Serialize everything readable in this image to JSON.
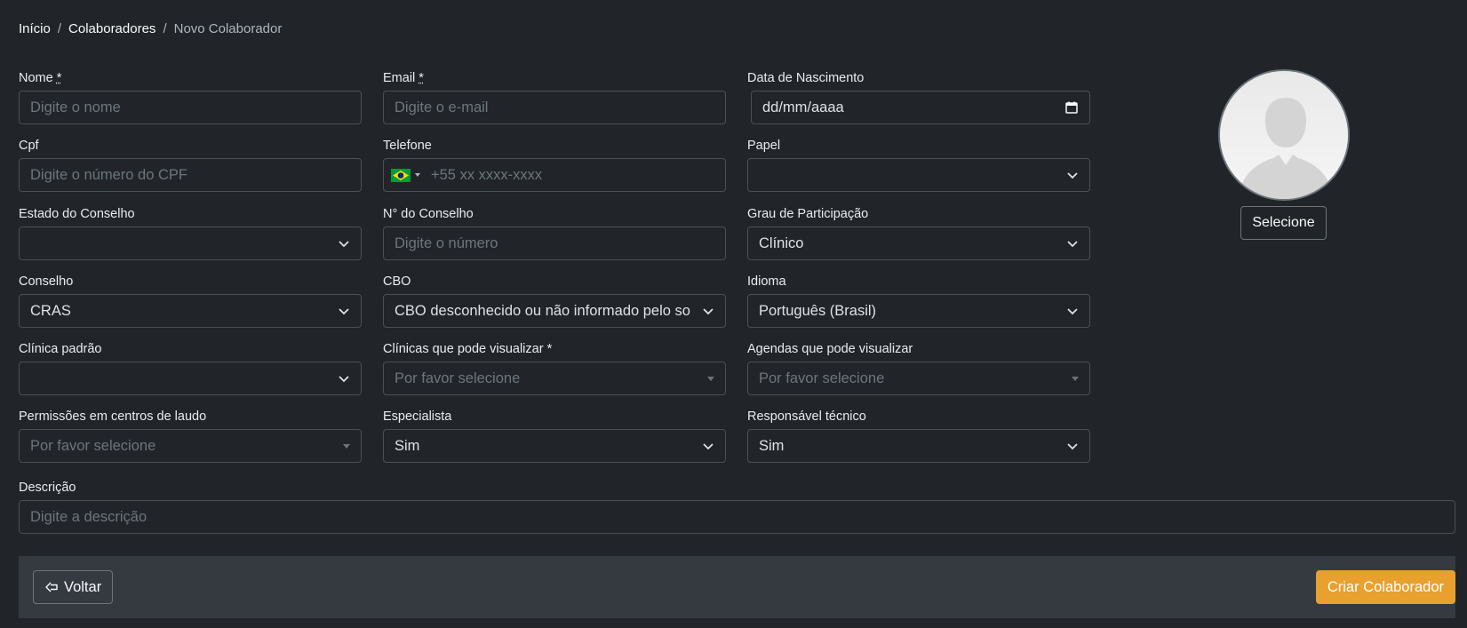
{
  "breadcrumb": {
    "home": "Início",
    "collaborators": "Colaboradores",
    "current": "Novo Colaborador",
    "separator": "/"
  },
  "fields": {
    "nome": {
      "label": "Nome",
      "required_mark": "*",
      "placeholder": "Digite o nome"
    },
    "email": {
      "label": "Email",
      "required_mark": "*",
      "placeholder": "Digite o e-mail"
    },
    "nascimento": {
      "label": "Data de Nascimento",
      "value": "dd/mm/aaaa"
    },
    "cpf": {
      "label": "Cpf",
      "placeholder": "Digite o número do CPF"
    },
    "telefone": {
      "label": "Telefone",
      "placeholder": "+55 xx xxxx-xxxx"
    },
    "papel": {
      "label": "Papel",
      "value": ""
    },
    "estado_conselho": {
      "label": "Estado do Conselho",
      "value": ""
    },
    "numero_conselho": {
      "label": "N° do Conselho",
      "placeholder": "Digite o número"
    },
    "grau": {
      "label": "Grau de Participação",
      "value": "Clínico"
    },
    "conselho": {
      "label": "Conselho",
      "value": "CRAS"
    },
    "cbo": {
      "label": "CBO",
      "value": "CBO desconhecido ou não informado pelo so"
    },
    "idioma": {
      "label": "Idioma",
      "value": "Português (Brasil)"
    },
    "clinica_padrao": {
      "label": "Clínica padrão",
      "value": ""
    },
    "clinicas_visualizar": {
      "label": "Clínicas que pode visualizar *",
      "placeholder": "Por favor selecione"
    },
    "agendas_visualizar": {
      "label": "Agendas que pode visualizar",
      "placeholder": "Por favor selecione"
    },
    "permissoes_laudo": {
      "label": "Permissões em centros de laudo",
      "placeholder": "Por favor selecione"
    },
    "especialista": {
      "label": "Especialista",
      "value": "Sim"
    },
    "responsavel_tecnico": {
      "label": "Responsável técnico",
      "value": "Sim"
    },
    "descricao": {
      "label": "Descrição",
      "placeholder": "Digite a descrição"
    }
  },
  "avatar": {
    "button_label": "Selecione"
  },
  "footer": {
    "back_label": "Voltar",
    "create_label": "Criar Colaborador"
  },
  "colors": {
    "background": "#212529",
    "footer": "#343a40",
    "accent": "#e8a02e",
    "border": "#495057"
  }
}
